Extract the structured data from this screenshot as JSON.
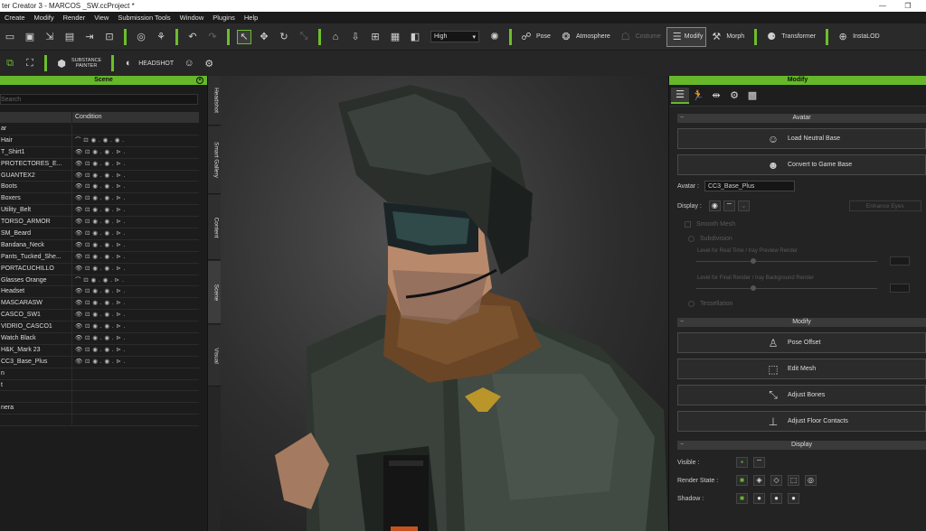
{
  "window": {
    "title": "ter Creator 3 - MARCOS _SW.ccProject *",
    "minimize_glyph": "—",
    "restore_glyph": "❐"
  },
  "menu": [
    "Create",
    "Modify",
    "Render",
    "View",
    "Submission Tools",
    "Window",
    "Plugins",
    "Help"
  ],
  "toolbar": {
    "quality": "High",
    "pose_label": "Pose",
    "atmosphere_label": "Atmosphere",
    "custom_label": "Costume",
    "modify_label": "Modify",
    "morph_label": "Morph",
    "transformer_label": "Transformer",
    "instalod_label": "InstaLOD",
    "substance_label_1": "SUBSTANCE",
    "substance_label_2": "PAINTER",
    "headshot_label": "HEADSHOT"
  },
  "scene_panel": {
    "title": "Scene",
    "search_placeholder": "Search",
    "col_name": "",
    "col_condition": "Condition",
    "rows": [
      {
        "name": "ar",
        "cond": ""
      },
      {
        "name": "Hair",
        "cond": "⌒  ⊡  ◉ .  ◉ .  ◉ ."
      },
      {
        "name": "T_Shirt1",
        "cond": "👁  ⊡  ◉ .  ◉ .  ⊳ ."
      },
      {
        "name": "PROTECTORES_E...",
        "cond": "👁  ⊡  ◉ .  ◉ .  ⊳ ."
      },
      {
        "name": "GUANTEX2",
        "cond": "👁  ⊡  ◉ .  ◉ .  ⊳ ."
      },
      {
        "name": "Boots",
        "cond": "👁  ⊡  ◉ .  ◉ .  ⊳ ."
      },
      {
        "name": "Boxers",
        "cond": "👁  ⊡  ◉ .  ◉ .  ⊳ ."
      },
      {
        "name": "Utility_Belt",
        "cond": "👁  ⊡  ◉ .  ◉ .  ⊳ ."
      },
      {
        "name": "TORSO_ARMOR",
        "cond": "👁  ⊡  ◉ .  ◉ .  ⊳ ."
      },
      {
        "name": "SM_Beard",
        "cond": "👁  ⊡  ◉ .  ◉ .  ⊳ ."
      },
      {
        "name": "Bandana_Neck",
        "cond": "👁  ⊡  ◉ .  ◉ .  ⊳ ."
      },
      {
        "name": "Pants_Tucked_She...",
        "cond": "👁  ⊡  ◉ .  ◉ .  ⊳ ."
      },
      {
        "name": "PORTACUCHILLO",
        "cond": "👁  ⊡  ◉ .  ◉ .  ⊳ ."
      },
      {
        "name": "Glasses Orange",
        "cond": "⌒  ⊡  ◉ .  ◉ .  ⊳ ."
      },
      {
        "name": "Headset",
        "cond": "👁  ⊡  ◉ .  ◉ .  ⊳ ."
      },
      {
        "name": "MASCARASW",
        "cond": "👁  ⊡  ◉ .  ◉ .  ⊳ ."
      },
      {
        "name": "CASCO_SW1",
        "cond": "👁  ⊡  ◉ .  ◉ .  ⊳ ."
      },
      {
        "name": "VIDRIO_CASCO1",
        "cond": "👁  ⊡  ◉ .  ◉ .  ⊳ ."
      },
      {
        "name": "Watch Black",
        "cond": "👁  ⊡  ◉ .  ◉ .  ⊳ ."
      },
      {
        "name": "H&K_Mark 23",
        "cond": "👁  ⊡  ◉ .  ◉ .  ⊳ ."
      },
      {
        "name": "CC3_Base_Plus",
        "cond": "👁  ⊡  ◉ .  ◉ .  ⊳ ."
      },
      {
        "name": "n",
        "cond": ""
      },
      {
        "name": "t",
        "cond": ""
      },
      {
        "name": "",
        "cond": ""
      },
      {
        "name": "nera",
        "cond": ""
      },
      {
        "name": "",
        "cond": ""
      }
    ]
  },
  "side_tabs": [
    "Headshot",
    "Smart Gallery",
    "Content",
    "Scene",
    "Visual"
  ],
  "modify_panel": {
    "title": "Modify",
    "avatar_section": "Avatar",
    "load_neutral_base": "Load Neutral Base",
    "convert_to_game_base": "Convert to Game Base",
    "avatar_label": "Avatar :",
    "avatar_value": "CC3_Base_Plus",
    "display_label": "Display :",
    "enhance_eyes": "Enhance Eyes",
    "smooth_mesh": "Smooth Mesh",
    "subdivision": "Subdivision",
    "level_realtime": "Level for Real Time / Iray Preview Render",
    "level_final": "Level for Final Render / Iray Background Render",
    "tessellation": "Tessellation",
    "modify_section": "Modify",
    "pose_offset": "Pose Offset",
    "edit_mesh": "Edit Mesh",
    "adjust_bones": "Adjust Bones",
    "adjust_floor_contacts": "Adjust Floor Contacts",
    "display_section": "Display",
    "visible_label": "Visible :",
    "render_state_label": "Render State :",
    "shadow_label": "Shadow :"
  },
  "colors": {
    "accent": "#66b82a",
    "panel": "#232323"
  }
}
